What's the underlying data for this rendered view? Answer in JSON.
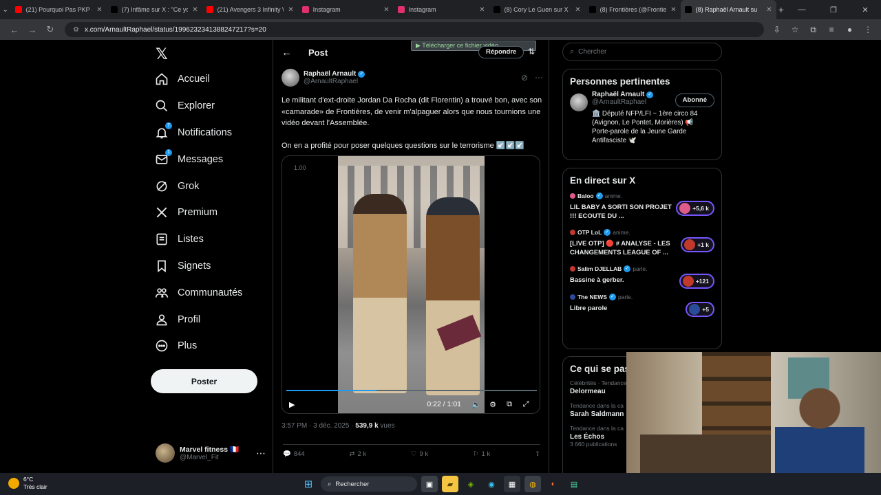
{
  "browser": {
    "tabs": [
      {
        "title": "(21) Pourquoi Pas PKP - Y",
        "fav": "#ff0000"
      },
      {
        "title": "(7) Infâme sur X : \"Ce you",
        "fav": "#000000"
      },
      {
        "title": "(21) Avengers 3 Infinity W",
        "fav": "#ff0000"
      },
      {
        "title": "Instagram",
        "fav": "#e1306c"
      },
      {
        "title": "Instagram",
        "fav": "#e1306c"
      },
      {
        "title": "(8) Cory Le Guen sur X : \"L",
        "fav": "#000000"
      },
      {
        "title": "(8) Frontières (@Frontiere",
        "fav": "#000000"
      },
      {
        "title": "(8) Raphaël Arnault su",
        "fav": "#000000"
      }
    ],
    "url": "x.com/ArnaultRaphael/status/1996232341388247217?s=20"
  },
  "nav": {
    "items": [
      {
        "label": "Accueil",
        "icon": "home-icon"
      },
      {
        "label": "Explorer",
        "icon": "search-icon"
      },
      {
        "label": "Notifications",
        "icon": "bell-icon",
        "badge": "7"
      },
      {
        "label": "Messages",
        "icon": "mail-icon",
        "badge": "1"
      },
      {
        "label": "Grok",
        "icon": "grok-icon"
      },
      {
        "label": "Premium",
        "icon": "x-logo-icon"
      },
      {
        "label": "Listes",
        "icon": "list-icon"
      },
      {
        "label": "Signets",
        "icon": "bookmark-icon"
      },
      {
        "label": "Communautés",
        "icon": "communities-icon"
      },
      {
        "label": "Profil",
        "icon": "profile-icon"
      },
      {
        "label": "Plus",
        "icon": "more-icon"
      }
    ],
    "post_label": "Poster",
    "account": {
      "name": "Marvel fitness 🇫🇷",
      "handle": "@Marvel_Fit"
    }
  },
  "post": {
    "header": "Post",
    "download_bar": "Télécharger ce fichier vidéo",
    "reply_label": "Répondre",
    "author": {
      "name": "Raphaël Arnault",
      "handle": "@ArnaultRaphael"
    },
    "text1": "Le militant d'ext-droite Jordan Da Rocha (dit Florentin) a trouvé bon, avec son «camarade» de Frontières, de venir m'alpaguer alors que nous tournions une vidéo devant l'Assemblée.",
    "text2": "On en a profité pour poser quelques questions sur le terrorisme ↙️↙️↙️",
    "video": {
      "rate": "1.00",
      "time": "0:22 / 1:01",
      "progress": 0.36
    },
    "meta_time": "3:57 PM · 3 déc. 2025 · ",
    "views_count": "539,9 k",
    "views_label": " vues",
    "stats": {
      "replies": "844",
      "reposts": "2 k",
      "likes": "9 k",
      "bookmarks": "1 k"
    }
  },
  "right": {
    "search_placeholder": "Chercher",
    "relevant_title": "Personnes pertinentes",
    "relevant": {
      "name": "Raphaël Arnault",
      "handle": "@ArnaultRaphael",
      "follow_label": "Abonné",
      "bio": "🏛️ Député NFP/LFI ~ 1ère circo 84 (Avignon, Le Pontet, Morières) 📢 Porte-parole de la Jeune Garde Antifasciste 🕊️"
    },
    "live_title": "En direct sur X",
    "live": [
      {
        "host": "Baloo",
        "action": "anime.",
        "title": "LIL BABY A SORTI SON PROJET !!! ECOUTE DU ...",
        "count": "+5,6 k",
        "color": "#e05a8a"
      },
      {
        "host": "OTP LoL",
        "action": "anime.",
        "title": "[LIVE OTP] 🔴 # ANALYSE - LES CHANGEMENTS LEAGUE OF ...",
        "count": "+1 k",
        "color": "#c0392b"
      },
      {
        "host": "Salim DJELLAB",
        "action": "parle.",
        "title": "Bassine à gerber.",
        "count": "+121",
        "color": "#c0392b"
      },
      {
        "host": "The NEWS",
        "action": "parle.",
        "title": "Libre parole",
        "count": "+5",
        "color": "#2a4a9a"
      }
    ],
    "trends_title": "Ce qui se passe",
    "trends": [
      {
        "context": "Célébrités · Tendance",
        "name": "Delormeau",
        "count": ""
      },
      {
        "context": "Tendance dans la ca",
        "name": "Sarah Saldmann",
        "count": ""
      },
      {
        "context": "Tendance dans la ca",
        "name": "Les Échos",
        "count": "3 660 publications"
      }
    ]
  },
  "taskbar": {
    "temp": "6°C",
    "weather": "Très clair",
    "search": "Rechercher"
  }
}
